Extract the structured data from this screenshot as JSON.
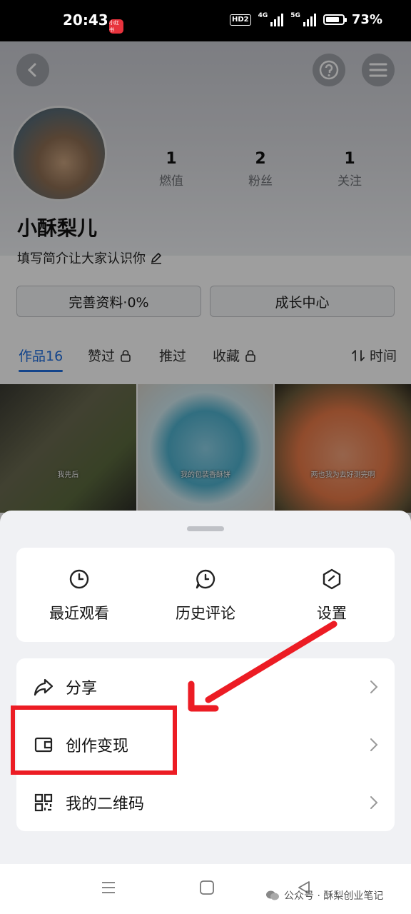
{
  "status_bar": {
    "time": "20:43",
    "app_badge": "小红书",
    "hd": "HD2",
    "net1": "4G",
    "net2": "5G",
    "battery": "73%"
  },
  "profile": {
    "stats": [
      {
        "value": "1",
        "label": "燃值"
      },
      {
        "value": "2",
        "label": "粉丝"
      },
      {
        "value": "1",
        "label": "关注"
      }
    ],
    "name": "小酥梨儿",
    "bio": "填写简介让大家认识你",
    "buttons": {
      "complete": "完善资料·0%",
      "growth": "成长中心"
    }
  },
  "tabs": {
    "works": "作品16",
    "liked": "赞过",
    "pushed": "推过",
    "favorites": "收藏",
    "sort": "时间"
  },
  "thumbnails": [
    {
      "caption": "我先后"
    },
    {
      "caption": "我的包装香酥饼"
    },
    {
      "caption": "两也我为去好测完啊"
    }
  ],
  "sheet": {
    "quick_actions": [
      {
        "icon": "clock-icon",
        "label": "最近观看"
      },
      {
        "icon": "comment-history-icon",
        "label": "历史评论"
      },
      {
        "icon": "settings-icon",
        "label": "设置"
      }
    ],
    "list": [
      {
        "icon": "share-icon",
        "label": "分享"
      },
      {
        "icon": "wallet-icon",
        "label": "创作变现"
      },
      {
        "icon": "qrcode-icon",
        "label": "我的二维码"
      }
    ]
  },
  "watermark": "公众号 · 酥梨创业笔记",
  "colors": {
    "accent": "#1f6fe0",
    "annotation": "#ec1c24"
  }
}
